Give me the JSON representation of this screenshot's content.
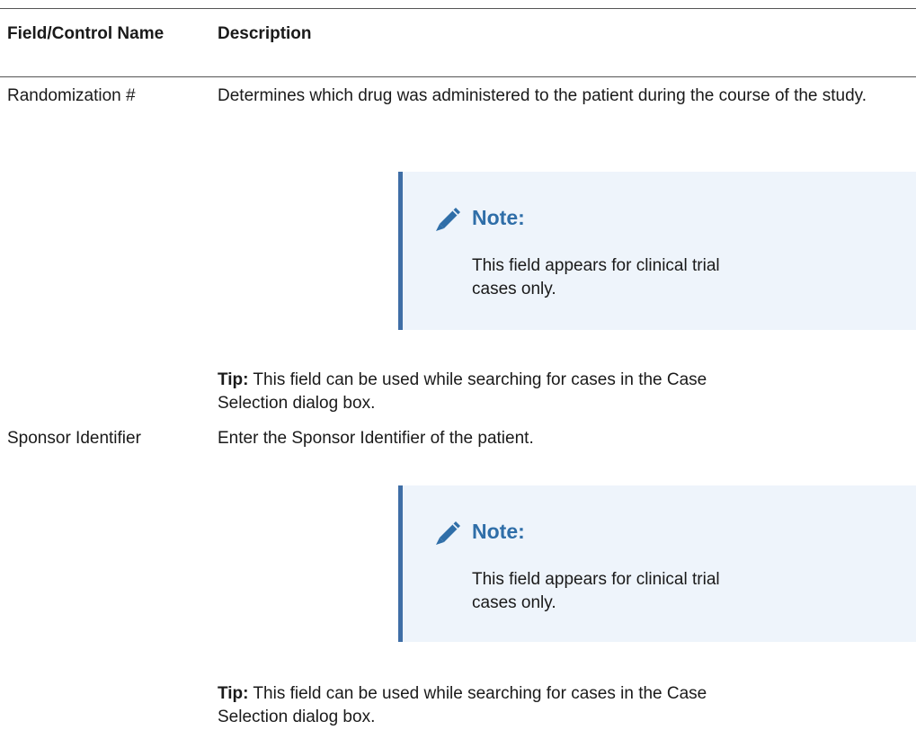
{
  "table": {
    "header": {
      "field": "Field/Control Name",
      "description": "Description"
    },
    "rows": [
      {
        "name": "Randomization #",
        "description": "Determines which drug was administered to the patient during the course of the study.",
        "note": {
          "title": "Note:",
          "text": "This field appears for clinical trial cases only."
        },
        "tip": {
          "label": "Tip:",
          "text": " This field can be used while searching for cases in the Case Selection dialog box."
        }
      },
      {
        "name": "Sponsor Identifier",
        "description": "Enter the Sponsor Identifier of the patient.",
        "note": {
          "title": "Note:",
          "text": "This field appears for clinical trial cases only."
        },
        "tip": {
          "label": "Tip:",
          "text": " This field can be used while searching for cases in the Case Selection dialog box."
        }
      }
    ]
  },
  "icons": {
    "note": "pencil-icon"
  },
  "colors": {
    "note_accent": "#3f6ea6",
    "note_title": "#2f6ea8",
    "note_background": "#eef4fb"
  }
}
